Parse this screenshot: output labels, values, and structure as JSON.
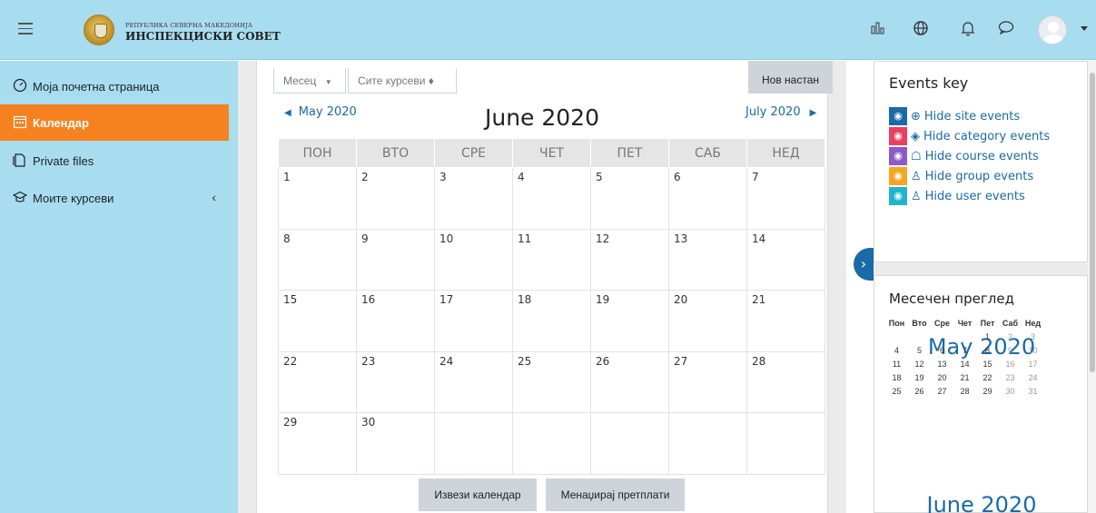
{
  "header": {
    "brand_top": "РЕПУБЛИКА СЕВЕРНА МАКЕДОНИЈА",
    "brand_bottom": "ИНСПЕКЦИСКИ СОВЕТ",
    "icons": [
      "menu-icon",
      "stats-icon",
      "globe-icon",
      "bell-icon",
      "chat-icon",
      "user-avatar"
    ]
  },
  "sidebar": {
    "items": [
      {
        "label": "Моја почетна страница",
        "icon": "dashboard-icon"
      },
      {
        "label": "Календар",
        "icon": "calendar-icon",
        "active": true
      },
      {
        "label": "Private files",
        "icon": "files-icon"
      },
      {
        "label": "Моите курсеви",
        "icon": "courses-icon"
      }
    ]
  },
  "calendar": {
    "view_select": "Месец",
    "course_select": "Сите курсеви ♦",
    "new_event": "Нов настан",
    "prev_month": "May 2020",
    "next_month": "July 2020",
    "title": "June 2020",
    "weekdays": [
      "ПОН",
      "ВТО",
      "СРЕ",
      "ЧЕТ",
      "ПЕТ",
      "САБ",
      "НЕД"
    ],
    "weeks": [
      [
        "1",
        "2",
        "3",
        "4",
        "5",
        "6",
        "7"
      ],
      [
        "8",
        "9",
        "10",
        "11",
        "12",
        "13",
        "14"
      ],
      [
        "15",
        "16",
        "17",
        "18",
        "19",
        "20",
        "21"
      ],
      [
        "22",
        "23",
        "24",
        "25",
        "26",
        "27",
        "28"
      ],
      [
        "29",
        "30",
        "",
        "",
        "",
        "",
        ""
      ]
    ],
    "export_button": "Извези календар",
    "subscriptions_button": "Менаџирај претплати"
  },
  "events_key": {
    "title": "Events key",
    "items": [
      {
        "label": "Hide site events",
        "color": "#1a6aa8",
        "glyph": "⊕"
      },
      {
        "label": "Hide category events",
        "color": "#e8405e",
        "glyph": "◈"
      },
      {
        "label": "Hide course events",
        "color": "#8e5ac8",
        "glyph": "☖"
      },
      {
        "label": "Hide group events",
        "color": "#f5a623",
        "glyph": "♙"
      },
      {
        "label": "Hide user events",
        "color": "#1fb5cc",
        "glyph": "♙"
      }
    ]
  },
  "month_overview": {
    "title": "Месечен преглед",
    "may_title": "May 2020",
    "june_title": "June 2020",
    "weekdays": [
      "Пон",
      "Вто",
      "Сре",
      "Чет",
      "Пет",
      "Саб",
      "Нед"
    ],
    "weeks": [
      [
        "",
        "",
        "",
        "",
        "1",
        "2",
        "3"
      ],
      [
        "4",
        "5",
        "6",
        "7",
        "8",
        "9",
        "10"
      ],
      [
        "11",
        "12",
        "13",
        "14",
        "15",
        "16",
        "17"
      ],
      [
        "18",
        "19",
        "20",
        "21",
        "22",
        "23",
        "24"
      ],
      [
        "25",
        "26",
        "27",
        "28",
        "29",
        "30",
        "31"
      ]
    ]
  }
}
